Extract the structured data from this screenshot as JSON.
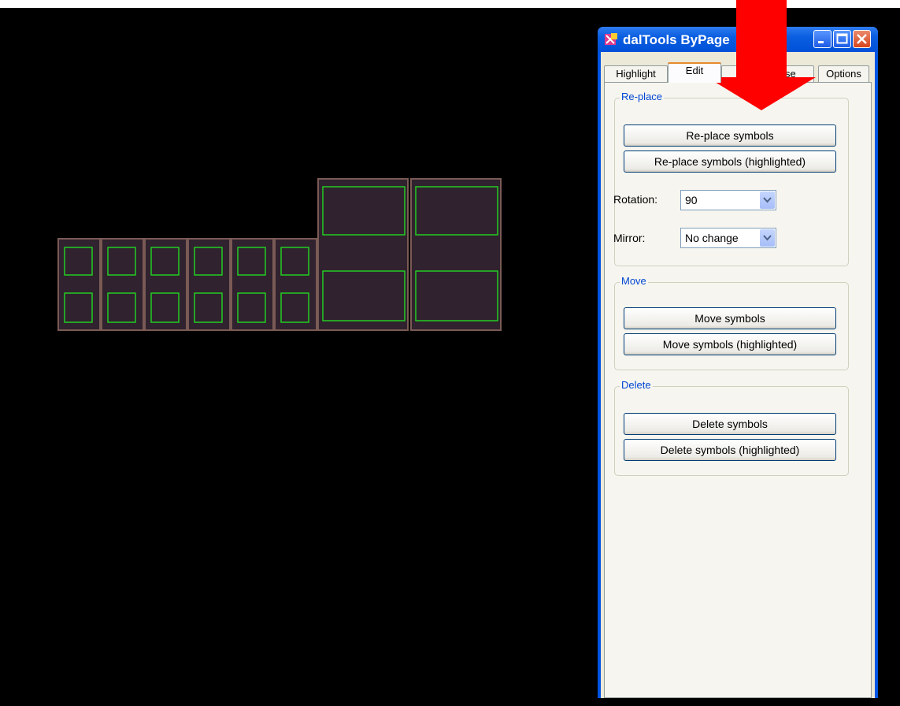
{
  "window": {
    "title": "dalTools ByPage",
    "icon": "app-icon",
    "controls": [
      "minimize-icon",
      "maximize-icon",
      "close-icon"
    ]
  },
  "tabs": [
    {
      "label": "Highlight",
      "selected": false
    },
    {
      "label": "Edit",
      "selected": true
    },
    {
      "label": "Page Reuse",
      "selected": false
    },
    {
      "label": "Options",
      "selected": false
    }
  ],
  "replace": {
    "group_label": "Re-place",
    "btn_replace": "Re-place symbols",
    "btn_replace_highlighted": "Re-place symbols (highlighted)",
    "rotation_label": "Rotation:",
    "rotation_value": "90",
    "mirror_label": "Mirror:",
    "mirror_value": "No change"
  },
  "move": {
    "group_label": "Move",
    "btn_move": "Move symbols",
    "btn_move_highlighted": "Move symbols (highlighted)"
  },
  "delete": {
    "group_label": "Delete",
    "btn_delete": "Delete symbols",
    "btn_delete_highlighted": "Delete symbols (highlighted)"
  },
  "colors": {
    "canvas": "#000000",
    "symbol_fill": "#30222e",
    "symbol_border": "#7a5a55",
    "outline_green": "#22cc22",
    "arrow": "#ff0000"
  }
}
